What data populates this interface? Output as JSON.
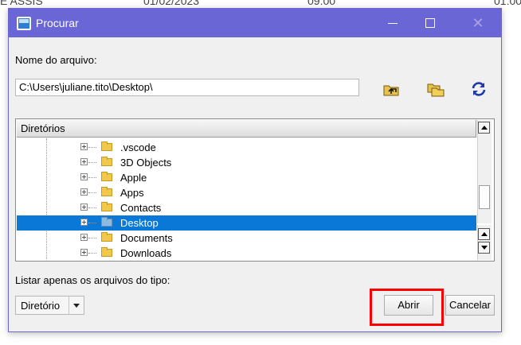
{
  "background": {
    "cells": [
      "E ASSIS",
      "01/02/2023",
      "09:00",
      "01:00"
    ]
  },
  "dialog": {
    "title": "Procurar",
    "close_glyph": "✕"
  },
  "file_name": {
    "label": "Nome do arquivo:",
    "value": "C:\\Users\\juliane.tito\\Desktop\\"
  },
  "toolbar": {
    "icons": [
      "folder-up-icon",
      "new-folder-icon",
      "refresh-icon"
    ]
  },
  "tree": {
    "header": "Diretórios",
    "items": [
      ".vscode",
      "3D Objects",
      "Apple",
      "Apps",
      "Contacts",
      "Desktop",
      "Documents",
      "Downloads"
    ],
    "selected": "Desktop"
  },
  "file_type": {
    "label": "Listar apenas os arquivos do tipo:",
    "value": "Diretório"
  },
  "buttons": {
    "open": "Abrir",
    "cancel": "Cancelar"
  },
  "colors": {
    "titlebar": "#6b66d6",
    "selection": "#0a78d7",
    "highlight": "#ff0000"
  }
}
